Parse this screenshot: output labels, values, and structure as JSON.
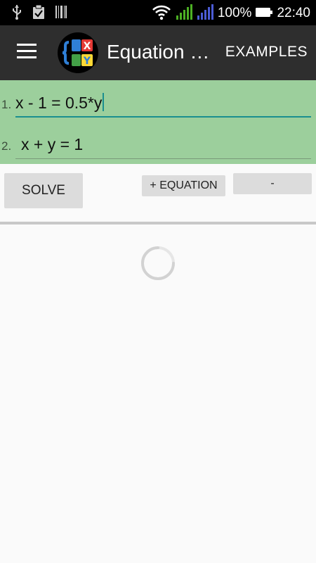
{
  "status_bar": {
    "icons": [
      "usb-icon",
      "clipboard-check-icon",
      "barcode-icon",
      "wifi-icon",
      "signal-green-icon",
      "signal-blue-icon",
      "battery-icon"
    ],
    "battery_percent": "100%",
    "time": "22:40",
    "colors": {
      "signal_green": "#4caf24",
      "signal_blue": "#4b5bd4"
    }
  },
  "app_bar": {
    "title": "Equation S...",
    "examples_label": "EXAMPLES",
    "logo_letters": [
      "X",
      "Y"
    ],
    "colors": {
      "background": "#2e2e2e",
      "logo_blue": "#2f7fd6",
      "logo_red": "#e53935",
      "logo_green": "#43a047",
      "logo_yellow": "#fdd835"
    }
  },
  "equations": [
    {
      "number": "1.",
      "value": "x - 1 = 0.5*y",
      "focused": true
    },
    {
      "number": "2.",
      "value": " x + y = 1",
      "focused": false
    }
  ],
  "equations_panel": {
    "background": "#9ccf9c",
    "focus_color": "#1a8f8f"
  },
  "buttons": {
    "solve": "SOLVE",
    "add_equation": "+ EQUATION",
    "remove_equation": "-"
  },
  "loading": {
    "icon": "loading-spinner-icon"
  }
}
